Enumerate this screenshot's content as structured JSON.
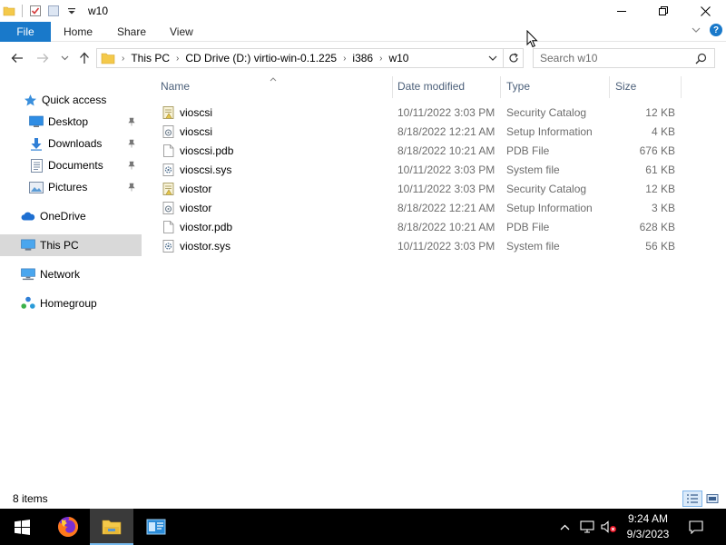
{
  "window": {
    "title": "w10"
  },
  "ribbon": {
    "file": "File",
    "home": "Home",
    "share": "Share",
    "view": "View"
  },
  "address": {
    "crumbs": [
      "This PC",
      "CD Drive (D:) virtio-win-0.1.225",
      "i386",
      "w10"
    ]
  },
  "search": {
    "placeholder": "Search w10"
  },
  "nav": {
    "quick_access": "Quick access",
    "desktop": "Desktop",
    "downloads": "Downloads",
    "documents": "Documents",
    "pictures": "Pictures",
    "onedrive": "OneDrive",
    "this_pc": "This PC",
    "network": "Network",
    "homegroup": "Homegroup"
  },
  "columns": {
    "name": "Name",
    "date": "Date modified",
    "type": "Type",
    "size": "Size"
  },
  "files": [
    {
      "name": "vioscsi",
      "date": "10/11/2022 3:03 PM",
      "type": "Security Catalog",
      "size": "12 KB",
      "icon": "security-catalog-icon"
    },
    {
      "name": "vioscsi",
      "date": "8/18/2022 12:21 AM",
      "type": "Setup Information",
      "size": "4 KB",
      "icon": "setup-info-icon"
    },
    {
      "name": "vioscsi.pdb",
      "date": "8/18/2022 10:21 AM",
      "type": "PDB File",
      "size": "676 KB",
      "icon": "blank-file-icon"
    },
    {
      "name": "vioscsi.sys",
      "date": "10/11/2022 3:03 PM",
      "type": "System file",
      "size": "61 KB",
      "icon": "system-file-icon"
    },
    {
      "name": "viostor",
      "date": "10/11/2022 3:03 PM",
      "type": "Security Catalog",
      "size": "12 KB",
      "icon": "security-catalog-icon"
    },
    {
      "name": "viostor",
      "date": "8/18/2022 12:21 AM",
      "type": "Setup Information",
      "size": "3 KB",
      "icon": "setup-info-icon"
    },
    {
      "name": "viostor.pdb",
      "date": "8/18/2022 10:21 AM",
      "type": "PDB File",
      "size": "628 KB",
      "icon": "blank-file-icon"
    },
    {
      "name": "viostor.sys",
      "date": "10/11/2022 3:03 PM",
      "type": "System file",
      "size": "56 KB",
      "icon": "system-file-icon"
    }
  ],
  "status": {
    "count": "8 items"
  },
  "taskbar": {
    "time": "9:24 AM",
    "date": "9/3/2023"
  },
  "colors": {
    "accent": "#1979ca",
    "selected": "#d9d9d9",
    "header_text": "#4c607a",
    "taskbar": "#000000"
  }
}
